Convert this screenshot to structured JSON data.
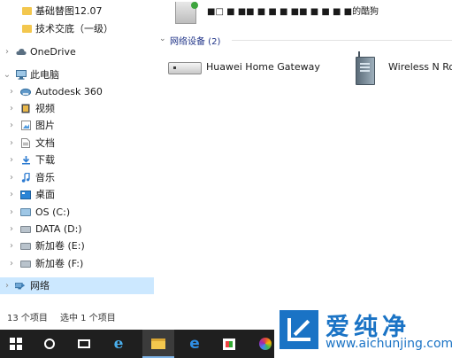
{
  "nav": {
    "items": [
      {
        "label": "基础替图12.07",
        "icon": "folder-icon",
        "chevron": "",
        "expanded": false,
        "selected": false
      },
      {
        "label": "技术交底（一级）",
        "icon": "folder-icon",
        "chevron": "",
        "expanded": false,
        "selected": false
      },
      {
        "label": "OneDrive",
        "icon": "cloud-icon",
        "chevron": "›",
        "expanded": false,
        "selected": false
      },
      {
        "label": "此电脑",
        "icon": "computer-icon",
        "chevron": "⌄",
        "expanded": true,
        "selected": false
      },
      {
        "label": "Autodesk 360",
        "icon": "cloud-drive-icon",
        "chevron": "›",
        "expanded": false,
        "selected": false
      },
      {
        "label": "视频",
        "icon": "video-folder-icon",
        "chevron": "›",
        "expanded": false,
        "selected": false
      },
      {
        "label": "图片",
        "icon": "picture-folder-icon",
        "chevron": "›",
        "expanded": false,
        "selected": false
      },
      {
        "label": "文档",
        "icon": "document-folder-icon",
        "chevron": "›",
        "expanded": false,
        "selected": false
      },
      {
        "label": "下载",
        "icon": "download-folder-icon",
        "chevron": "›",
        "expanded": false,
        "selected": false
      },
      {
        "label": "音乐",
        "icon": "music-folder-icon",
        "chevron": "›",
        "expanded": false,
        "selected": false
      },
      {
        "label": "桌面",
        "icon": "desktop-folder-icon",
        "chevron": "›",
        "expanded": false,
        "selected": false
      },
      {
        "label": "OS (C:)",
        "icon": "os-drive-icon",
        "chevron": "›",
        "expanded": false,
        "selected": false
      },
      {
        "label": "DATA (D:)",
        "icon": "drive-icon",
        "chevron": "›",
        "expanded": false,
        "selected": false
      },
      {
        "label": "新加卷 (E:)",
        "icon": "drive-icon",
        "chevron": "›",
        "expanded": false,
        "selected": false
      },
      {
        "label": "新加卷 (F:)",
        "icon": "drive-icon",
        "chevron": "›",
        "expanded": false,
        "selected": false
      },
      {
        "label": "网络",
        "icon": "network-icon",
        "chevron": "›",
        "expanded": false,
        "selected": true
      }
    ]
  },
  "content": {
    "top_item_label": "■□ ■ ■■ ■ ■ ■ ■■ ■ ■ ■ ■的酷狗",
    "group": {
      "chevron": "⌄",
      "label": "网络设备 (2)"
    },
    "devices": [
      {
        "label": "Huawei Home Gateway",
        "icon": "gateway-icon"
      },
      {
        "label": "Wireless N Ro",
        "icon": "router-icon"
      }
    ]
  },
  "status": {
    "count": "13 个项目",
    "selected": "选中 1 个项目"
  },
  "taskbar": {
    "items": [
      {
        "name": "start-button",
        "icon": "windows-logo-icon",
        "active": false
      },
      {
        "name": "cortana-button",
        "icon": "cortana-icon",
        "active": false
      },
      {
        "name": "task-view-button",
        "icon": "task-view-icon",
        "active": false
      },
      {
        "name": "internet-explorer-button",
        "icon": "internet-explorer-icon",
        "glyph": "e",
        "active": false
      },
      {
        "name": "file-explorer-button",
        "icon": "file-explorer-icon",
        "active": true
      },
      {
        "name": "edge-button",
        "icon": "edge-icon",
        "glyph": "e",
        "active": false
      },
      {
        "name": "store-button",
        "icon": "store-icon",
        "active": false
      },
      {
        "name": "color-app-button",
        "icon": "color-app-icon",
        "active": false
      }
    ]
  },
  "watermark": {
    "brand": "爱纯净",
    "url": "www.aichunjing.com",
    "accent": "#1a73c5"
  },
  "colors": {
    "selection": "#cce8ff",
    "taskbar": "#1f1f1f",
    "group_header": "#1e3287"
  }
}
